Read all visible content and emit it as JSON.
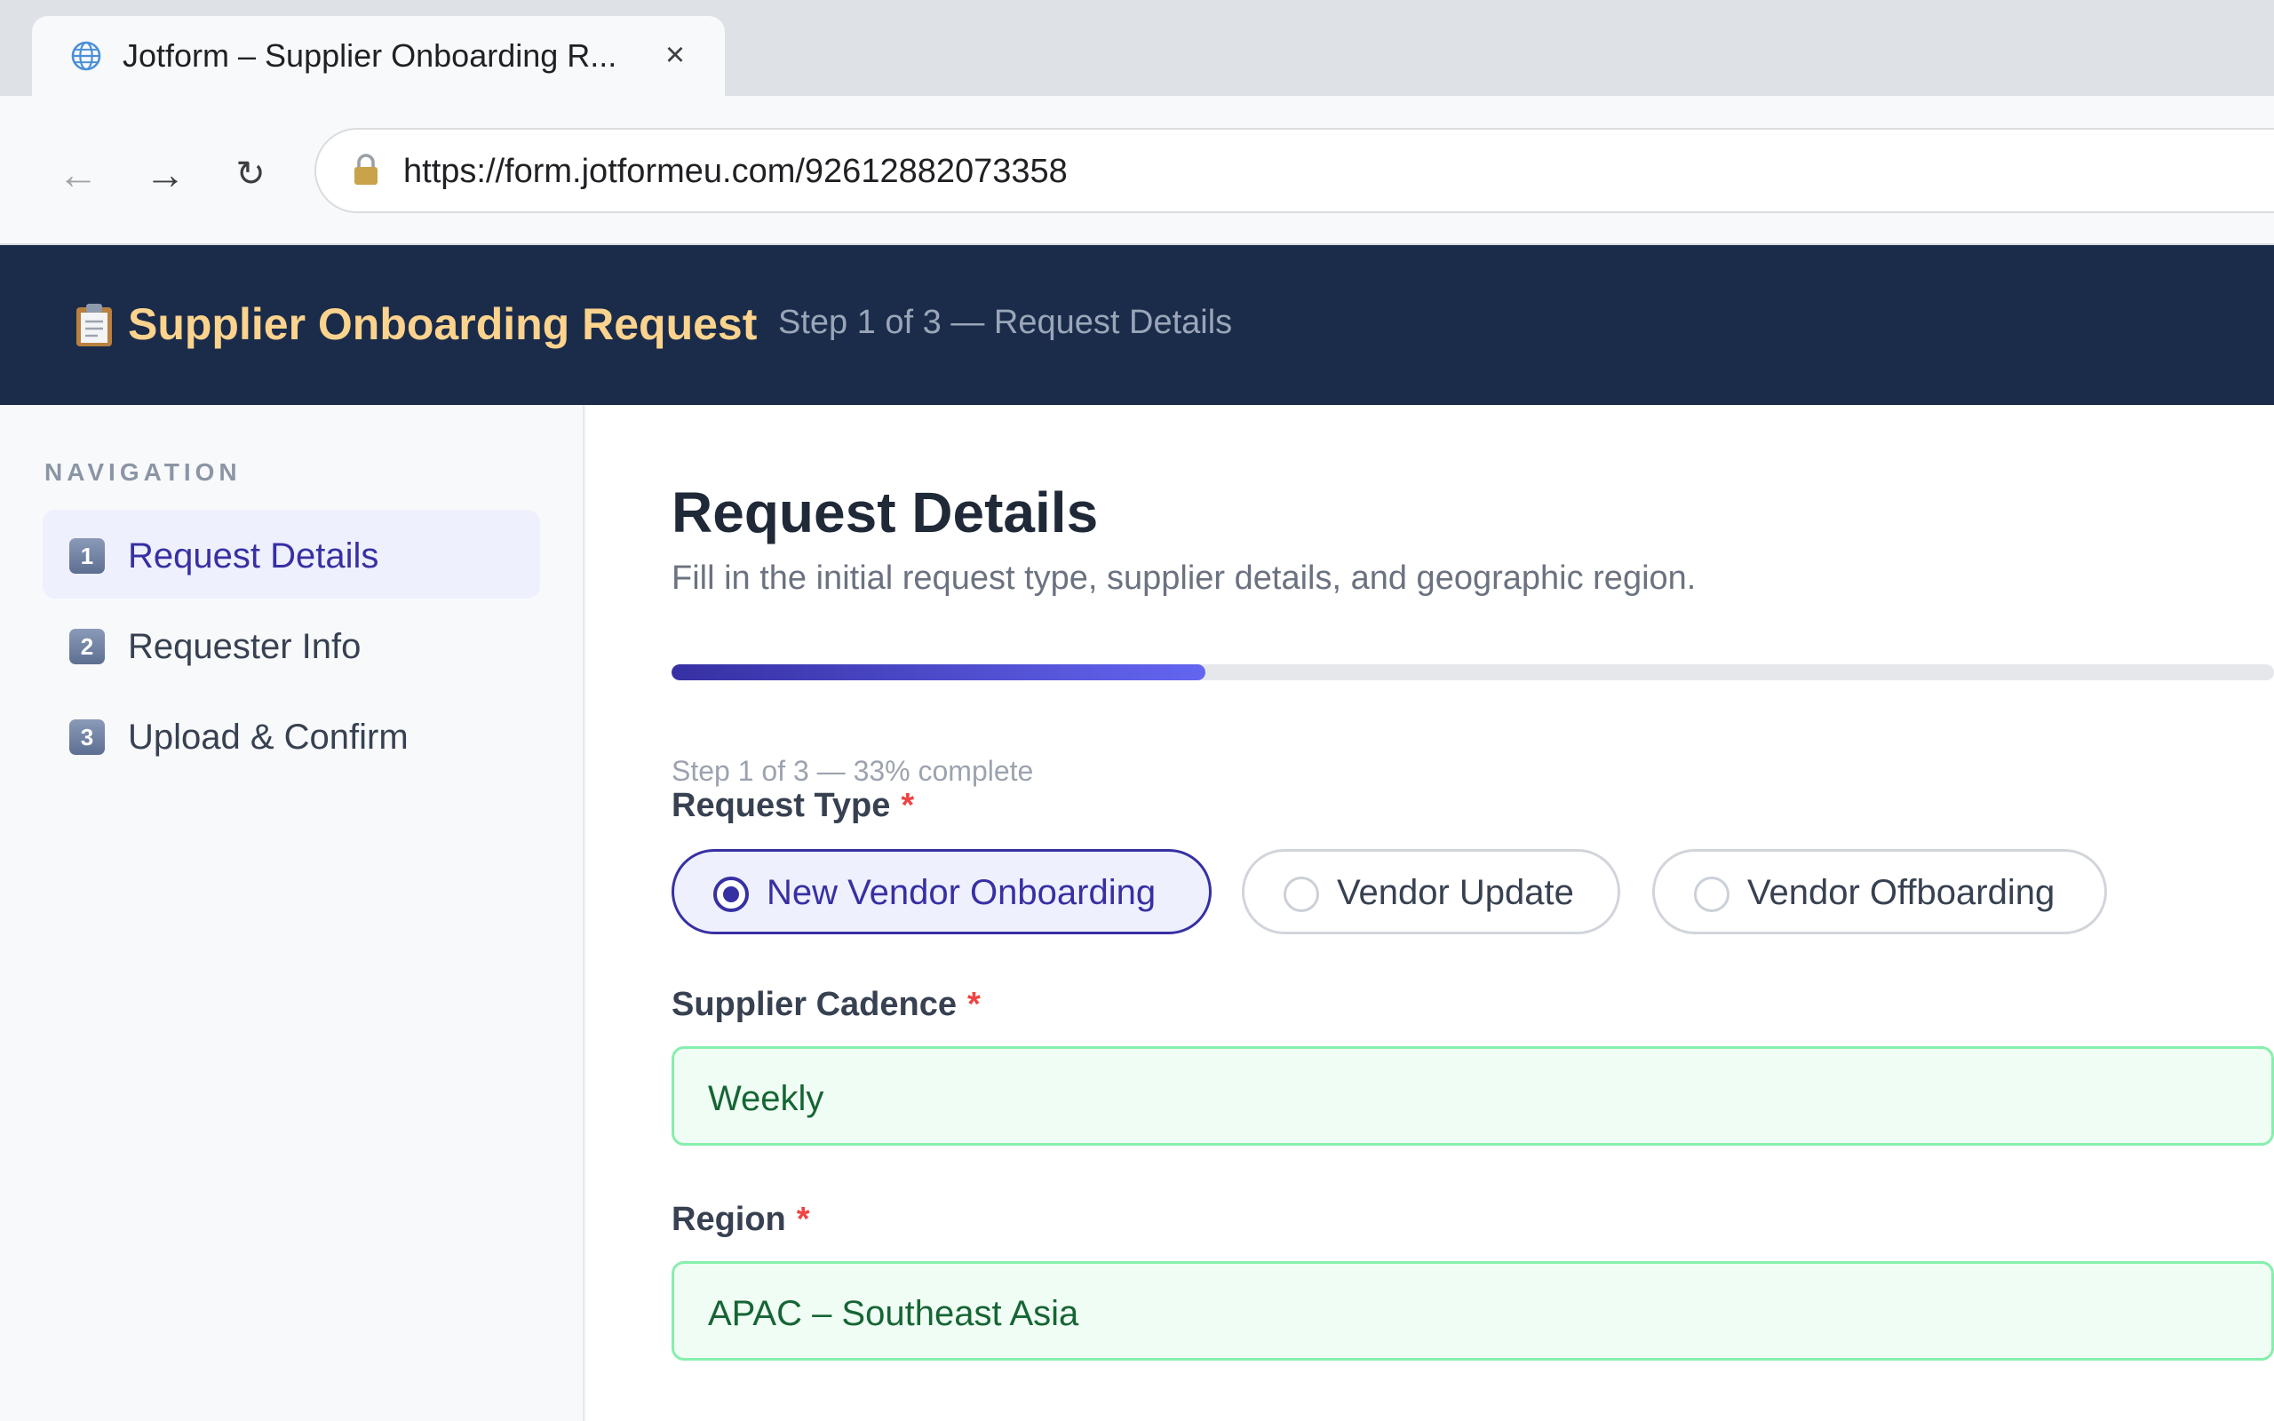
{
  "browser": {
    "tab_title": "Jotform – Supplier Onboarding R...",
    "url": "https://form.jotformeu.com/92612882073358"
  },
  "header": {
    "title": "Supplier Onboarding Request",
    "step": "Step 1 of 3 — Request Details"
  },
  "sidebar": {
    "heading": "NAVIGATION",
    "items": [
      {
        "num": "1",
        "label": "Request Details"
      },
      {
        "num": "2",
        "label": "Requester Info"
      },
      {
        "num": "3",
        "label": "Upload & Confirm"
      }
    ]
  },
  "main": {
    "title": "Request Details",
    "subtitle": "Fill in the initial request type, supplier details, and geographic region.",
    "progress_fraction": 0.3333,
    "progress_text": "Step 1 of 3 — 33% complete",
    "request_type": {
      "label": "Request Type",
      "required": "*",
      "options": [
        "New Vendor Onboarding",
        "Vendor Update",
        "Vendor Offboarding"
      ],
      "selected": "New Vendor Onboarding"
    },
    "supplier_cadence": {
      "label": "Supplier Cadence",
      "required": "*",
      "value": "Weekly"
    },
    "region": {
      "label": "Region",
      "required": "*",
      "value": "APAC – Southeast Asia"
    }
  },
  "colors": {
    "header_bg": "#1b2c4b",
    "header_title": "#fcd38d",
    "accent": "#3730a3",
    "valid_border": "#86efac",
    "valid_bg": "#f0fdf4",
    "required": "#ef4444"
  },
  "icons": {
    "tab": "globe-icon",
    "url": "lock-icon",
    "header": "clipboard-icon",
    "back": "arrow-left-icon",
    "forward": "arrow-right-icon",
    "reload": "reload-icon",
    "close": "close-icon"
  }
}
